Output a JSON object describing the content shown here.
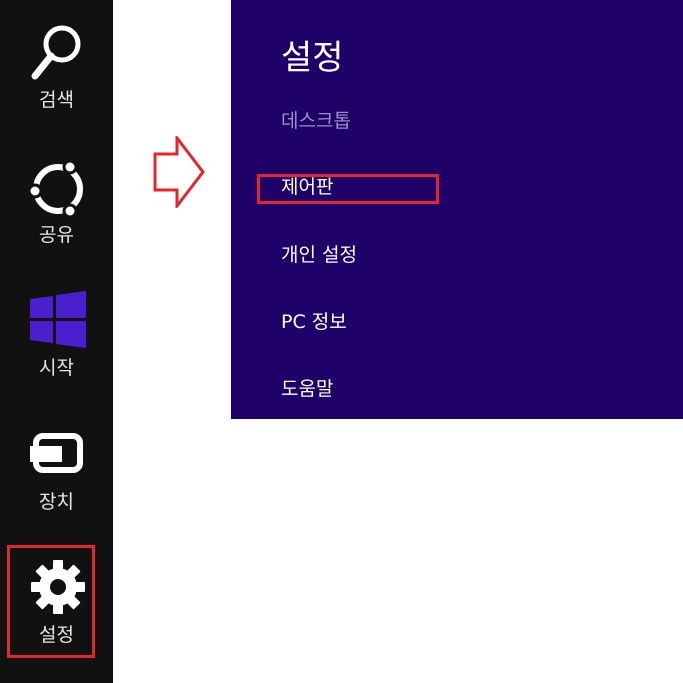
{
  "charms": {
    "search_label": "검색",
    "share_label": "공유",
    "start_label": "시작",
    "devices_label": "장치",
    "settings_label": "설정",
    "icons": {
      "search": "search-icon",
      "share": "share-icon",
      "start": "windows-logo-icon",
      "devices": "devices-icon",
      "settings": "gear-icon"
    },
    "start_logo_color": "#4b1fd0"
  },
  "settings_pane": {
    "title": "설정",
    "items": [
      "데스크톱",
      "제어판",
      "개인 설정",
      "PC 정보",
      "도움말"
    ],
    "background_color": "#1f0068"
  },
  "annotations": {
    "highlight_color": "#e3262e"
  }
}
